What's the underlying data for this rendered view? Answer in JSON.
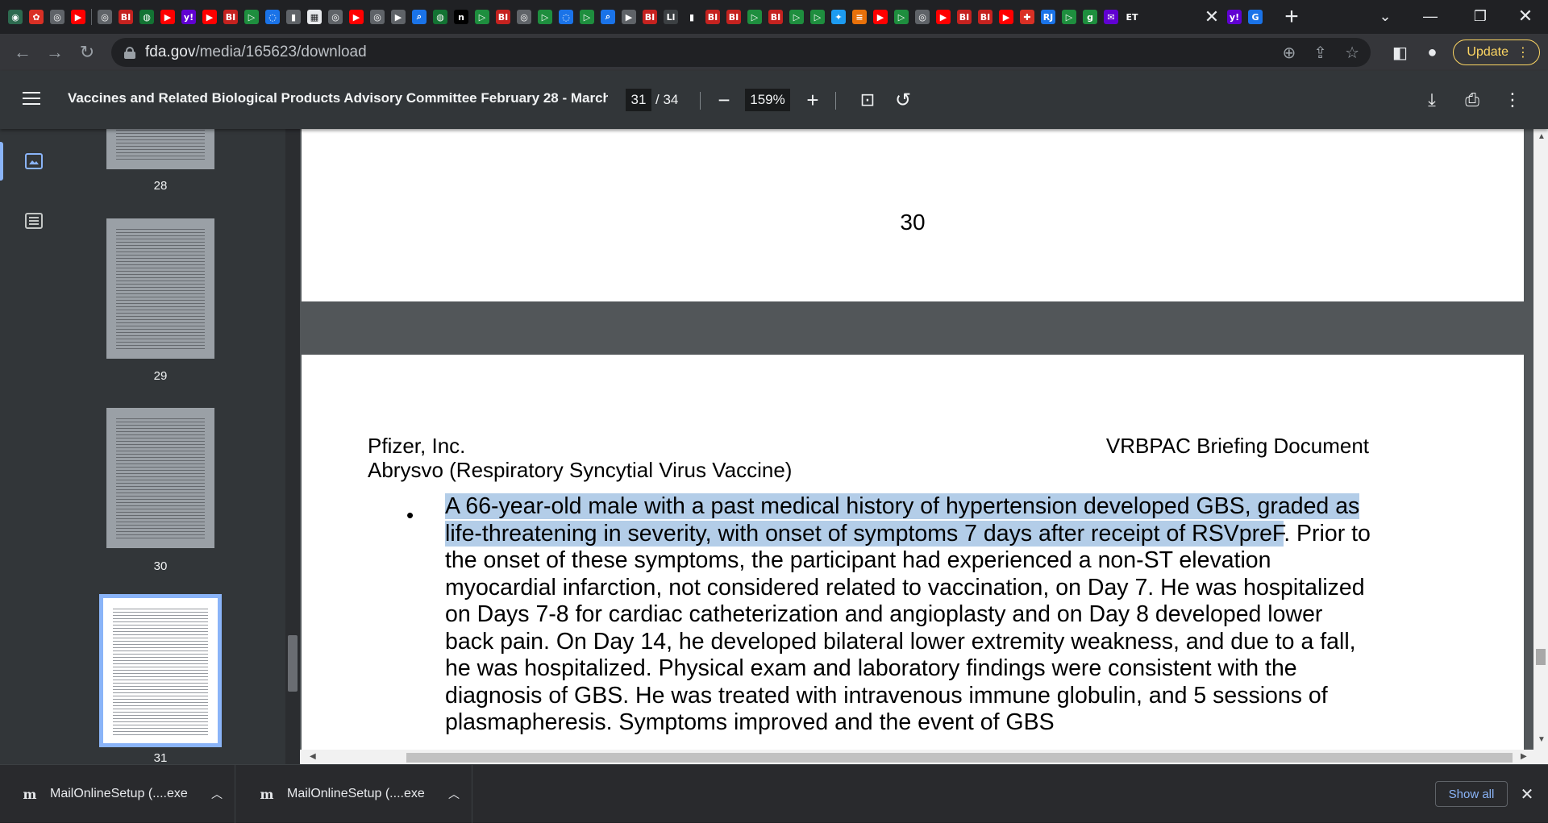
{
  "colors": {
    "chrome_bg": "#202124",
    "toolbar_bg": "#35363a",
    "pdf_toolbar_bg": "#323639",
    "viewer_bg": "#525659",
    "highlight": "#b3cde8",
    "update_accent": "#fdd663",
    "link_blue": "#8ab4f8"
  },
  "tabs": {
    "favicons": [
      {
        "icon": "globe-icon",
        "glyph": "◉",
        "bg": "#2d6a4f"
      },
      {
        "icon": "app-icon",
        "glyph": "✿",
        "bg": "#d93025"
      },
      {
        "icon": "web-icon",
        "glyph": "◎",
        "bg": "#5f6368"
      },
      {
        "icon": "youtube-icon",
        "glyph": "▶",
        "bg": "#ff0000"
      },
      {
        "icon": "sep",
        "glyph": "",
        "bg": ""
      },
      {
        "icon": "web-icon",
        "glyph": "◎",
        "bg": "#5f6368"
      },
      {
        "icon": "bi-icon",
        "glyph": "BI",
        "bg": "#c5221f"
      },
      {
        "icon": "web-icon",
        "glyph": "◍",
        "bg": "#137333"
      },
      {
        "icon": "youtube-icon",
        "glyph": "▶",
        "bg": "#ff0000"
      },
      {
        "icon": "yahoo-icon",
        "glyph": "y!",
        "bg": "#6001d2"
      },
      {
        "icon": "youtube-icon",
        "glyph": "▶",
        "bg": "#ff0000"
      },
      {
        "icon": "bi-icon",
        "glyph": "BI",
        "bg": "#c5221f"
      },
      {
        "icon": "play-icon",
        "glyph": "▷",
        "bg": "#1e8e3e"
      },
      {
        "icon": "web-icon",
        "glyph": "◌",
        "bg": "#1a73e8"
      },
      {
        "icon": "web-icon",
        "glyph": "▮",
        "bg": "#5f6368"
      },
      {
        "icon": "web-icon",
        "glyph": "▦",
        "bg": "#e8eaed"
      },
      {
        "icon": "web-icon",
        "glyph": "◎",
        "bg": "#5f6368"
      },
      {
        "icon": "youtube-icon",
        "glyph": "▶",
        "bg": "#ff0000"
      },
      {
        "icon": "web-icon",
        "glyph": "◎",
        "bg": "#5f6368"
      },
      {
        "icon": "web-icon",
        "glyph": "▶",
        "bg": "#5f6368"
      },
      {
        "icon": "search-icon",
        "glyph": "⌕",
        "bg": "#1a73e8"
      },
      {
        "icon": "web-icon",
        "glyph": "◍",
        "bg": "#137333"
      },
      {
        "icon": "n-icon",
        "glyph": "n",
        "bg": "#000000"
      },
      {
        "icon": "play-icon",
        "glyph": "▷",
        "bg": "#1e8e3e"
      },
      {
        "icon": "bi-icon",
        "glyph": "BI",
        "bg": "#c5221f"
      },
      {
        "icon": "web-icon",
        "glyph": "◎",
        "bg": "#5f6368"
      },
      {
        "icon": "play-icon",
        "glyph": "▷",
        "bg": "#1e8e3e"
      },
      {
        "icon": "web-icon",
        "glyph": "◌",
        "bg": "#1a73e8"
      },
      {
        "icon": "play-icon",
        "glyph": "▷",
        "bg": "#1e8e3e"
      },
      {
        "icon": "search-icon",
        "glyph": "⌕",
        "bg": "#1a73e8"
      },
      {
        "icon": "web-icon",
        "glyph": "▶",
        "bg": "#5f6368"
      },
      {
        "icon": "bi-icon",
        "glyph": "BI",
        "bg": "#c5221f"
      },
      {
        "icon": "web-icon",
        "glyph": "Ll",
        "bg": "#3c4043"
      },
      {
        "icon": "web-icon",
        "glyph": "▮",
        "bg": "#202124"
      },
      {
        "icon": "bi-icon",
        "glyph": "BI",
        "bg": "#c5221f"
      },
      {
        "icon": "bi-icon",
        "glyph": "BI",
        "bg": "#c5221f"
      },
      {
        "icon": "play-icon",
        "glyph": "▷",
        "bg": "#1e8e3e"
      },
      {
        "icon": "bi-icon",
        "glyph": "BI",
        "bg": "#c5221f"
      },
      {
        "icon": "play-icon",
        "glyph": "▷",
        "bg": "#1e8e3e"
      },
      {
        "icon": "play-icon",
        "glyph": "▷",
        "bg": "#1e8e3e"
      },
      {
        "icon": "twitter-icon",
        "glyph": "✦",
        "bg": "#1d9bf0"
      },
      {
        "icon": "web-icon",
        "glyph": "≡",
        "bg": "#e8710a"
      },
      {
        "icon": "youtube-icon",
        "glyph": "▶",
        "bg": "#ff0000"
      },
      {
        "icon": "play-icon",
        "glyph": "▷",
        "bg": "#1e8e3e"
      },
      {
        "icon": "web-icon",
        "glyph": "◎",
        "bg": "#5f6368"
      },
      {
        "icon": "youtube-icon",
        "glyph": "▶",
        "bg": "#ff0000"
      },
      {
        "icon": "bi-icon",
        "glyph": "BI",
        "bg": "#c5221f"
      },
      {
        "icon": "bi-icon",
        "glyph": "BI",
        "bg": "#c5221f"
      },
      {
        "icon": "youtube-icon",
        "glyph": "▶",
        "bg": "#ff0000"
      },
      {
        "icon": "web-icon",
        "glyph": "✚",
        "bg": "#d93025"
      },
      {
        "icon": "web-icon",
        "glyph": "RJ",
        "bg": "#1a73e8"
      },
      {
        "icon": "play-icon",
        "glyph": "▷",
        "bg": "#1e8e3e"
      },
      {
        "icon": "web-icon",
        "glyph": "g",
        "bg": "#1e8e3e"
      },
      {
        "icon": "web-icon",
        "glyph": "✉",
        "bg": "#6001d2"
      },
      {
        "icon": "et-icon",
        "glyph": "ET",
        "bg": "#202124"
      }
    ],
    "active_close": "✕",
    "after_active": [
      {
        "icon": "yahoo-icon",
        "glyph": "y!",
        "bg": "#6001d2"
      },
      {
        "icon": "google-icon",
        "glyph": "G",
        "bg": "#1a73e8"
      }
    ],
    "new_tab": "+"
  },
  "address": {
    "host": "fda.gov",
    "path": "/media/165623/download"
  },
  "toolbar": {
    "update_label": "Update"
  },
  "pdf": {
    "title": "Vaccines and Related Biological Products Advisory Committee February 28 - March ...",
    "current_page": "31",
    "total_pages": "/ 34",
    "zoom": "159%"
  },
  "thumbnails": [
    {
      "label": "28"
    },
    {
      "label": "29"
    },
    {
      "label": "30"
    },
    {
      "label": "31"
    }
  ],
  "document": {
    "prev_page_number": "30",
    "header_company": "Pfizer, Inc.",
    "header_product": "Abrysvo (Respiratory Syncytial Virus Vaccine)",
    "header_right": "VRBPAC Briefing Document",
    "bullet": "•",
    "highlighted_text": "A 66-year-old male with a past medical history of hypertension developed GBS, graded as life-threatening in severity, with onset of symptoms 7 days after receipt of RSVpreF",
    "body_text": ". Prior to the onset of these symptoms, the participant had experienced a non-ST elevation myocardial infarction, not considered related to vaccination, on Day 7. He was hospitalized on Days 7-8 for cardiac catheterization and angioplasty and on Day 8 developed lower back pain. On Day 14, he developed bilateral lower extremity weakness, and due to a fall, he was hospitalized. Physical exam and laboratory findings were consistent with the diagnosis of GBS. He was treated with intravenous immune globulin, and 5 sessions of plasmapheresis. Symptoms improved and the event of GBS"
  },
  "downloads": {
    "items": [
      {
        "name": "MailOnlineSetup (....exe"
      },
      {
        "name": "MailOnlineSetup (....exe"
      }
    ],
    "show_all": "Show all"
  }
}
